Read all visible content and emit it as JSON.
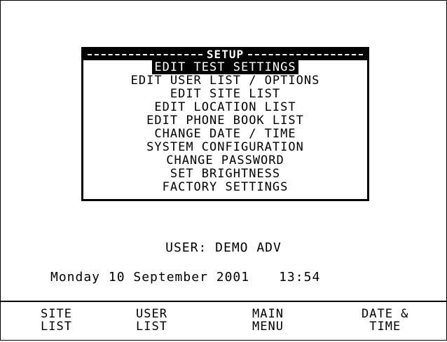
{
  "setup_menu": {
    "title": "SETUP",
    "items": [
      {
        "label": "EDIT TEST SETTINGS",
        "selected": true
      },
      {
        "label": "EDIT USER LIST / OPTIONS",
        "selected": false
      },
      {
        "label": "EDIT SITE LIST",
        "selected": false
      },
      {
        "label": "EDIT LOCATION LIST",
        "selected": false
      },
      {
        "label": "EDIT PHONE BOOK LIST",
        "selected": false
      },
      {
        "label": "CHANGE DATE / TIME",
        "selected": false
      },
      {
        "label": "SYSTEM CONFIGURATION",
        "selected": false
      },
      {
        "label": "CHANGE PASSWORD",
        "selected": false
      },
      {
        "label": "SET BRIGHTNESS",
        "selected": false
      },
      {
        "label": "FACTORY SETTINGS",
        "selected": false
      }
    ]
  },
  "status": {
    "user_label": "USER:",
    "user_name": "DEMO ADV",
    "date": "Monday 10 September 2001",
    "time": "13:54"
  },
  "softkeys": [
    {
      "line1": "SITE",
      "line2": "LIST"
    },
    {
      "line1": "USER",
      "line2": "LIST"
    },
    {
      "line1": "MAIN",
      "line2": "MENU"
    },
    {
      "line1": "DATE &",
      "line2": "TIME"
    }
  ]
}
